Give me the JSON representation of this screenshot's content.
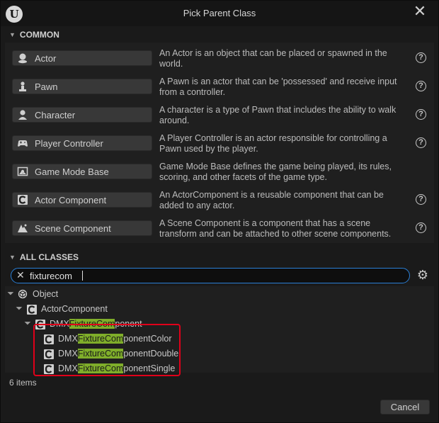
{
  "window": {
    "title": "Pick Parent Class"
  },
  "common": {
    "header": "COMMON",
    "items": [
      {
        "label": "Actor",
        "description": "An Actor is an object that can be placed or spawned in the world.",
        "icon": "actor-icon",
        "has_help": true
      },
      {
        "label": "Pawn",
        "description": "A Pawn is an actor that can be 'possessed' and receive input from a controller.",
        "icon": "pawn-icon",
        "has_help": true
      },
      {
        "label": "Character",
        "description": "A character is a type of Pawn that includes the ability to walk around.",
        "icon": "character-icon",
        "has_help": true
      },
      {
        "label": "Player Controller",
        "description": "A Player Controller is an actor responsible for controlling a Pawn used by the player.",
        "icon": "gamepad-icon",
        "has_help": true
      },
      {
        "label": "Game Mode Base",
        "description": "Game Mode Base defines the game being played, its rules, scoring, and other facets of the game type.",
        "icon": "game-mode-icon",
        "has_help": false
      },
      {
        "label": "Actor Component",
        "description": "An ActorComponent is a reusable component that can be added to any actor.",
        "icon": "component-icon",
        "has_help": true
      },
      {
        "label": "Scene Component",
        "description": "A Scene Component is a component that has a scene transform and can be attached to other scene components.",
        "icon": "scene-component-icon",
        "has_help": true
      }
    ]
  },
  "all_classes": {
    "header": "ALL CLASSES",
    "search": {
      "value": "fixturecom",
      "placeholder": ""
    },
    "tree": [
      {
        "depth": 0,
        "expanded": true,
        "icon": "object-icon",
        "parts": [
          "Object"
        ]
      },
      {
        "depth": 1,
        "expanded": true,
        "icon": "component-icon",
        "parts": [
          "ActorComponent"
        ]
      },
      {
        "depth": 2,
        "expanded": true,
        "icon": "component-icon",
        "parts": [
          "DMX",
          "FixtureCom",
          "ponent"
        ]
      },
      {
        "depth": 3,
        "expanded": false,
        "icon": "component-icon",
        "parts": [
          "DMX",
          "FixtureCom",
          "ponentColor"
        ]
      },
      {
        "depth": 3,
        "expanded": false,
        "icon": "component-icon",
        "parts": [
          "DMX",
          "FixtureCom",
          "ponentDouble"
        ]
      },
      {
        "depth": 3,
        "expanded": false,
        "icon": "component-icon",
        "parts": [
          "DMX",
          "FixtureCom",
          "ponentSingle"
        ]
      }
    ],
    "item_count": "6 items"
  },
  "footer": {
    "cancel_label": "Cancel"
  },
  "colors": {
    "highlight": "#7fae2a",
    "annotation_box": "#e0001a",
    "search_border": "#2a7fd6"
  }
}
